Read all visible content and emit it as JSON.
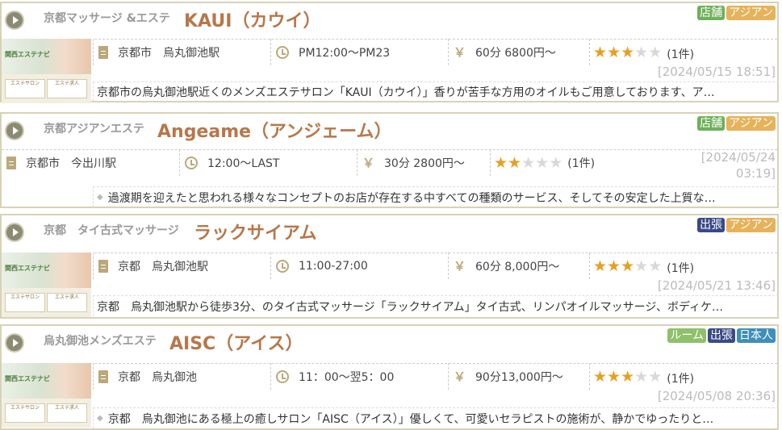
{
  "listings": [
    {
      "category": "京都マッサージ &エステ",
      "name": "KAUI（カウイ）",
      "tags": [
        "店舗",
        "アジアン"
      ],
      "area": "京都市　烏丸御池駅",
      "hours": "PM12:00〜PM23",
      "price": "60分 6800円〜",
      "rating": 3,
      "reviews": "(1件)",
      "date": "[2024/05/15 18:51]",
      "description": "京都市の烏丸御池駅近くのメンズエステサロン「KAUI（カウイ）」香りが苦手な方用のオイルもご用意しております、ア…"
    },
    {
      "category": "京都アジアンエステ",
      "name": "Angeame（アンジェーム）",
      "tags": [
        "店舗",
        "アジアン"
      ],
      "area": "京都市　今出川駅",
      "hours": "12:00〜LAST",
      "price": "30分 2800円〜",
      "rating": 2,
      "reviews": "(1件)",
      "date_line1": "[2024/05/24",
      "date_line2": "03:19]",
      "description": "過渡期を迎えたと思われる様々なコンセプトのお店が存在する中すべての種類のサービス、そしてその安定した上質な…"
    },
    {
      "category": "京都　タイ古式マッサージ",
      "name": "ラックサイアム",
      "tags": [
        "出張",
        "アジアン"
      ],
      "area": "京都　烏丸御池駅",
      "hours": "11:00-27:00",
      "price": "60分 8,000円〜",
      "rating": 3,
      "reviews": "(1件)",
      "date": "[2024/05/21 13:46]",
      "description": "京都　烏丸御池駅から徒歩3分、のタイ古式マッサージ「ラックサイアム」タイ古式、リンパオイルマッサージ、ボディケ…"
    },
    {
      "category": "烏丸御池メンズエステ",
      "name": "AISC（アイス）",
      "tags": [
        "ルーム",
        "出張",
        "日本人"
      ],
      "area": "京都　烏丸御池",
      "hours": "11：00〜翌5：00",
      "price": "90分13,000円〜",
      "rating": 3,
      "reviews": "(1件)",
      "date": "[2024/05/08 20:36]",
      "description": "京都　烏丸御池にある極上の癒しサロン「AISC（アイス）」優しくて、可愛いセラピストの施術が、静かでゆったりと…"
    }
  ],
  "thumbnail": {
    "logo": "関西エステナビ",
    "button1": "エステサロン",
    "button2": "エステ求人"
  },
  "stars": {
    "on": "★",
    "off": "★"
  },
  "colors": {
    "shop": "#6fb05a",
    "asian": "#e6b25a",
    "dispatch": "#3a4a86",
    "room": "#8fc06a",
    "japanese": "#3f8fb8",
    "name": "#b8774a"
  }
}
